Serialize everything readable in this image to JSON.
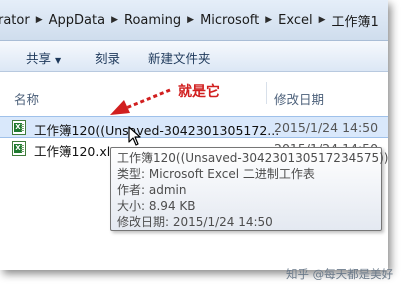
{
  "address_bar": {
    "segments": [
      "rator",
      "AppData",
      "Roaming",
      "Microsoft",
      "Excel",
      "工作簿1"
    ]
  },
  "toolbar": {
    "share_label": "共享",
    "burn_label": "刻录",
    "new_folder_label": "新建文件夹"
  },
  "columns": {
    "name": "名称",
    "date_modified": "修改日期"
  },
  "files": [
    {
      "name": "工作簿120((Unsaved-3042301305172...",
      "date": "2015/1/24 14:50"
    },
    {
      "name": "工作簿120.xlsx",
      "date": "2015/1/24 14:50"
    }
  ],
  "annotation": {
    "text": "就是它",
    "color": "#d11f1f"
  },
  "tooltip": {
    "title": "工作簿120((Unsaved-304230130517234575))",
    "type": "类型: Microsoft Excel 二进制工作表",
    "author": "作者: admin",
    "size": "大小: 8.94 KB",
    "modified": "修改日期: 2015/1/24 14:50"
  },
  "watermark": "知乎 @每天都是美好",
  "icons": {
    "file": "excel-file-icon",
    "chevron": "chevron-right-icon"
  }
}
